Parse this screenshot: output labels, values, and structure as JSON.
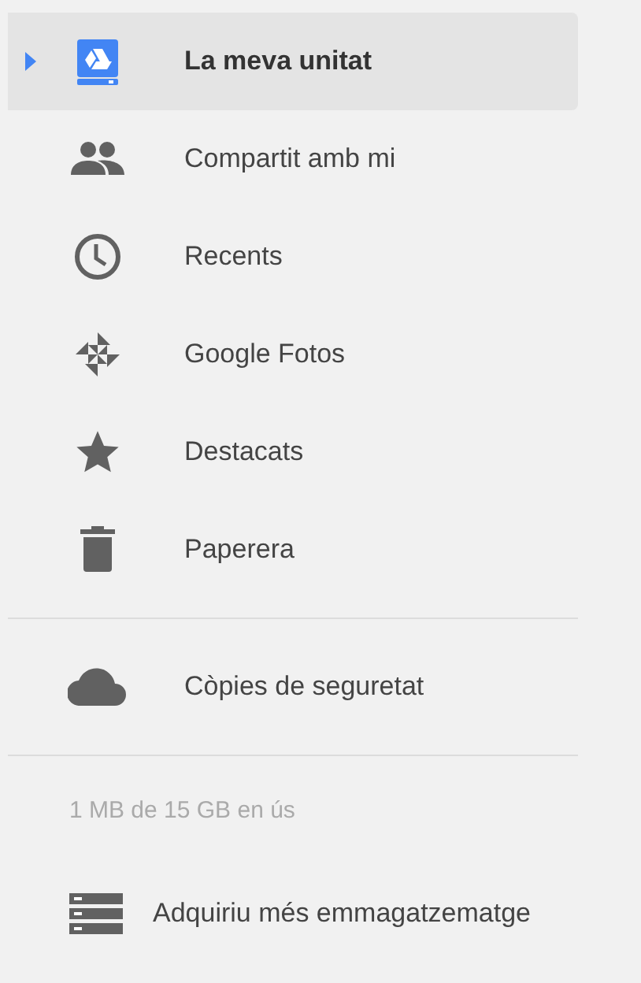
{
  "nav": [
    {
      "label": "La meva unitat",
      "selected": true,
      "expandable": true
    },
    {
      "label": "Compartit amb mi",
      "selected": false,
      "expandable": false
    },
    {
      "label": "Recents",
      "selected": false,
      "expandable": false
    },
    {
      "label": "Google Fotos",
      "selected": false,
      "expandable": false
    },
    {
      "label": "Destacats",
      "selected": false,
      "expandable": false
    },
    {
      "label": "Paperera",
      "selected": false,
      "expandable": false
    }
  ],
  "backups": {
    "label": "Còpies de seguretat",
    "selected": false
  },
  "storage": {
    "usage": "1 MB de 15 GB en ús",
    "buy_label": "Adquiriu més emmagatzematge"
  }
}
